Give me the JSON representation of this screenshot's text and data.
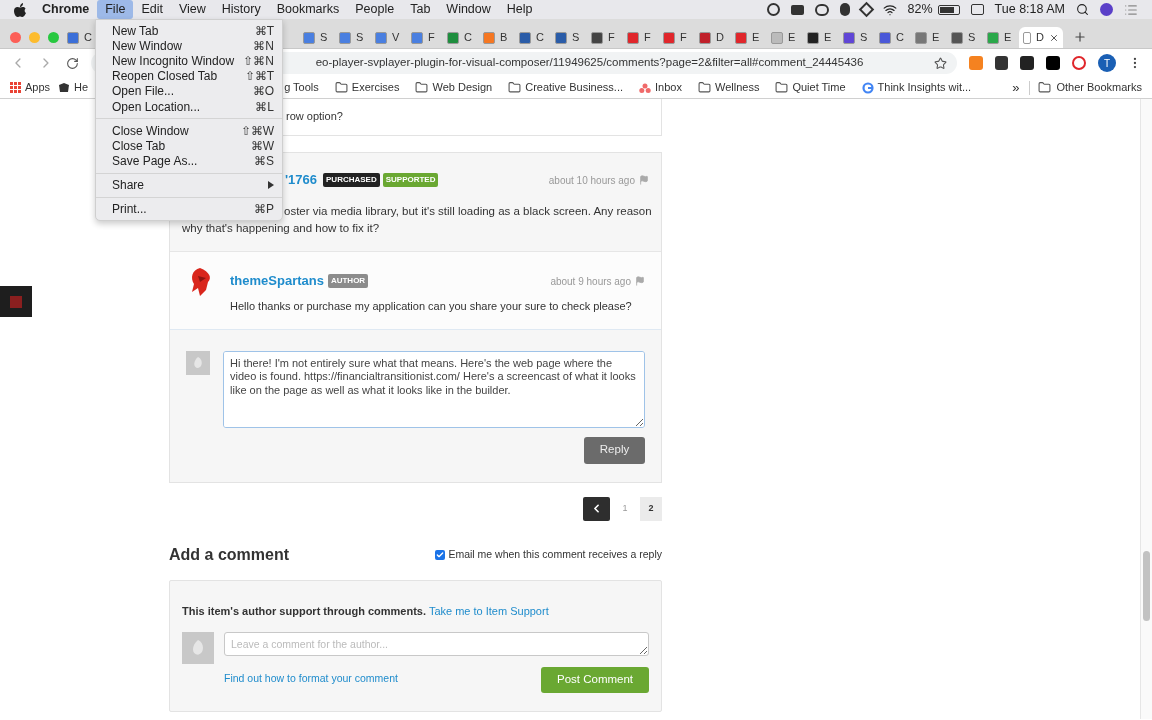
{
  "menubar": {
    "app": "Chrome",
    "menus": [
      {
        "label": "File",
        "selected": true
      },
      {
        "label": "Edit",
        "selected": false
      },
      {
        "label": "View",
        "selected": false
      },
      {
        "label": "History",
        "selected": false
      },
      {
        "label": "Bookmarks",
        "selected": false
      },
      {
        "label": "People",
        "selected": false
      },
      {
        "label": "Tab",
        "selected": false
      },
      {
        "label": "Window",
        "selected": false
      },
      {
        "label": "Help",
        "selected": false
      }
    ],
    "battery": "82%",
    "clock": "Tue 8:18 AM"
  },
  "tabs_left": [
    {
      "letter": "C",
      "color": "#3b6fd8",
      "selected": false
    }
  ],
  "tabs": [
    {
      "letter": "S",
      "color": "#4a7fe0",
      "selected": false
    },
    {
      "letter": "S",
      "color": "#4a7fe0",
      "selected": false
    },
    {
      "letter": "V",
      "color": "#4a7fe0",
      "selected": false
    },
    {
      "letter": "F",
      "color": "#4a7fe0",
      "selected": false
    },
    {
      "letter": "C",
      "color": "#1e8e3e",
      "selected": false
    },
    {
      "letter": "B",
      "color": "#f57722",
      "selected": false
    },
    {
      "letter": "C",
      "color": "#2a5ca8",
      "selected": false
    },
    {
      "letter": "S",
      "color": "#2a5ca8",
      "selected": false
    },
    {
      "letter": "F",
      "color": "#444444",
      "selected": false
    },
    {
      "letter": "F",
      "color": "#e0262b",
      "selected": false
    },
    {
      "letter": "F",
      "color": "#e0262b",
      "selected": false
    },
    {
      "letter": "D",
      "color": "#c0202a",
      "selected": false
    },
    {
      "letter": "E",
      "color": "#e0262b",
      "selected": false
    },
    {
      "letter": "E",
      "color": "#bbbbbb",
      "selected": false
    },
    {
      "letter": "E",
      "color": "#222222",
      "selected": false
    },
    {
      "letter": "S",
      "color": "#6046d6",
      "selected": false
    },
    {
      "letter": "C",
      "color": "#4a58d8",
      "selected": false
    },
    {
      "letter": "E",
      "color": "#777777",
      "selected": false
    },
    {
      "letter": "S",
      "color": "#555555",
      "selected": false
    },
    {
      "letter": "E",
      "color": "#2aa84a",
      "selected": false
    },
    {
      "letter": "D",
      "color": "#ffffff",
      "selected": true
    }
  ],
  "toolbar": {
    "url": "eo-player-svplayer-plugin-for-visual-composer/11949625/comments?page=2&filter=all#comment_24445436",
    "profile_initial": "T"
  },
  "bookmarks": [
    {
      "label": "Apps",
      "kind": "apps"
    },
    {
      "label": "He",
      "kind": "site"
    },
    {
      "label": "g Tools",
      "kind": "text"
    },
    {
      "label": "Exercises",
      "kind": "folder"
    },
    {
      "label": "Web Design",
      "kind": "folder"
    },
    {
      "label": "Creative Business...",
      "kind": "folder"
    },
    {
      "label": "Inbox",
      "kind": "dots"
    },
    {
      "label": "Wellness",
      "kind": "folder"
    },
    {
      "label": "Quiet Time",
      "kind": "folder"
    },
    {
      "label": "Think Insights wit...",
      "kind": "google"
    }
  ],
  "bookmarks_more": "»",
  "other_bookmarks": "Other Bookmarks",
  "file_menu": [
    [
      {
        "label": "New Tab",
        "shortcut": "⌘T",
        "submenu": false
      },
      {
        "label": "New Window",
        "shortcut": "⌘N",
        "submenu": false
      },
      {
        "label": "New Incognito Window",
        "shortcut": "⇧⌘N",
        "submenu": false
      },
      {
        "label": "Reopen Closed Tab",
        "shortcut": "⇧⌘T",
        "submenu": false
      },
      {
        "label": "Open File...",
        "shortcut": "⌘O",
        "submenu": false
      },
      {
        "label": "Open Location...",
        "shortcut": "⌘L",
        "submenu": false
      }
    ],
    [
      {
        "label": "Close Window",
        "shortcut": "⇧⌘W",
        "submenu": false
      },
      {
        "label": "Close Tab",
        "shortcut": "⌘W",
        "submenu": false
      },
      {
        "label": "Save Page As...",
        "shortcut": "⌘S",
        "submenu": false
      }
    ],
    [
      {
        "label": "Share",
        "submenu": true
      }
    ],
    [
      {
        "label": "Print...",
        "shortcut": "⌘P",
        "submenu": false
      }
    ]
  ],
  "thread": {
    "previous_comment_text": "row option?",
    "comment": {
      "author": "'1766",
      "badges": [
        {
          "label": "PURCHASED",
          "color": "#222222"
        },
        {
          "label": "SUPPORTED",
          "color": "#6aa832"
        }
      ],
      "time": "about 10 hours ago",
      "text_lines": [
        "oster via media library, but it's still loading as a black screen. Any reason",
        "why that's happening and how to fix it?"
      ]
    },
    "reply": {
      "author": "themeSpartans",
      "badges": [
        {
          "label": "AUTHOR",
          "color": "#8c8c8c"
        }
      ],
      "time": "about 9 hours ago",
      "text": "Hello thanks or purchase my application can you share your sure to check please?"
    },
    "reply_form": {
      "value": "Hi there! I'm not entirely sure what that means. Here's the web page where the video is found. https://financialtransitionist.com/ Here's a screencast of what it looks like on the page as well as what it looks like in the builder.\n\n",
      "button": "Reply"
    }
  },
  "pagination": [
    {
      "label": "1",
      "selected": false
    },
    {
      "label": "2",
      "selected": true
    }
  ],
  "add_comment": {
    "title": "Add a comment",
    "email_option": {
      "label": "Email me when this comment receives a reply",
      "checked": true
    },
    "notice": "This item's author support through comments.",
    "notice_link": "Take me to Item Support",
    "placeholder": "Leave a comment for the author...",
    "format_link": "Find out how to format your comment",
    "button": "Post Comment"
  }
}
